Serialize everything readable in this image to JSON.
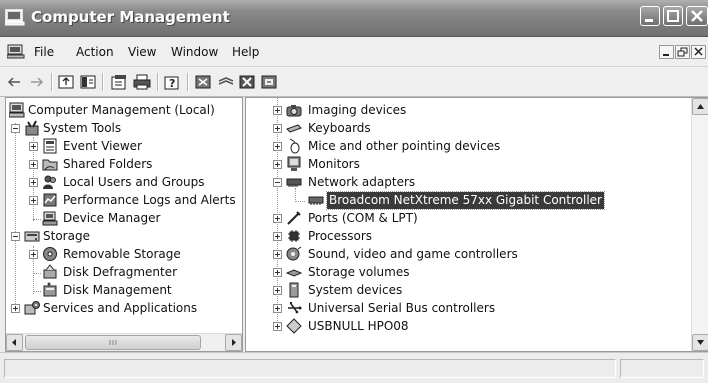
{
  "window": {
    "title": "Computer Management",
    "controls": [
      "minimize",
      "maximize",
      "close"
    ]
  },
  "menubar": {
    "items": [
      "File",
      "Action",
      "View",
      "Window",
      "Help"
    ]
  },
  "toolbar": {
    "buttons": [
      "back-icon",
      "forward-icon",
      "up-icon",
      "show-hide-tree-icon",
      "properties-icon",
      "print-icon",
      "help-icon",
      "scan-hardware-icon",
      "uninstall-icon",
      "disable-icon",
      "update-driver-icon"
    ]
  },
  "left_tree": {
    "root": "Computer Management (Local)",
    "system_tools": "System Tools",
    "event_viewer": "Event Viewer",
    "shared_folders": "Shared Folders",
    "local_users": "Local Users and Groups",
    "performance": "Performance Logs and Alerts",
    "device_manager": "Device Manager",
    "storage": "Storage",
    "removable_storage": "Removable Storage",
    "disk_defrag": "Disk Defragmenter",
    "disk_mgmt": "Disk Management",
    "services": "Services and Applications"
  },
  "device_tree": {
    "items": [
      "Imaging devices",
      "Keyboards",
      "Mice and other pointing devices",
      "Monitors",
      "Network adapters",
      "Broadcom NetXtreme 57xx Gigabit Controller",
      "Ports (COM & LPT)",
      "Processors",
      "Sound, video and game controllers",
      "Storage volumes",
      "System devices",
      "Universal Serial Bus controllers",
      "USBNULL HPO08"
    ],
    "selected": "Broadcom NetXtreme 57xx Gigabit Controller"
  },
  "colors": {
    "selection": "#3a3a3a",
    "titlebar": "#7c7c7c"
  }
}
